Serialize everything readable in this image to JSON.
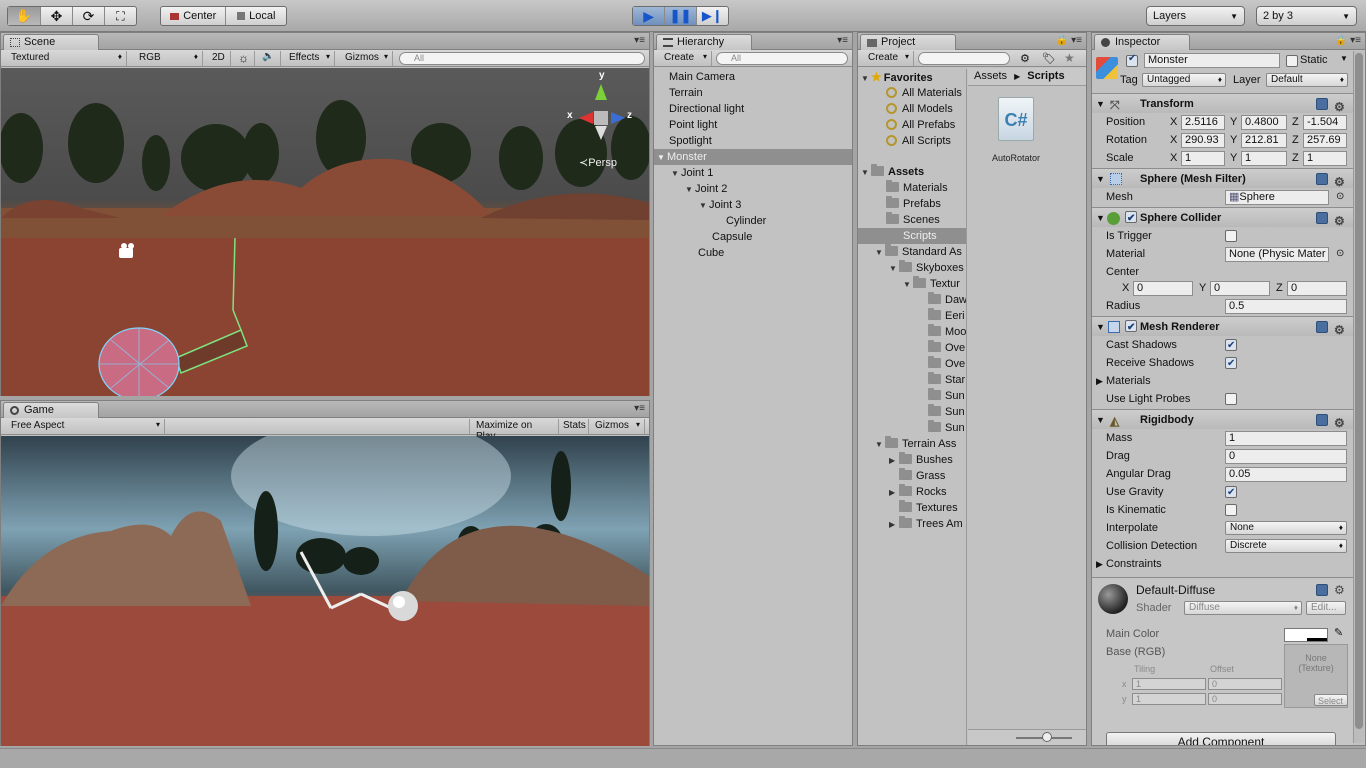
{
  "toolbar": {
    "pivot": "Center",
    "space": "Local",
    "layers": "Layers",
    "layout": "2 by 3"
  },
  "scene": {
    "tab": "Scene",
    "shading": "Textured",
    "render_mode": "RGB",
    "btn_2d": "2D",
    "effects": "Effects",
    "gizmos": "Gizmos",
    "search_placeholder": "All",
    "persp": "Persp",
    "axis_y": "y",
    "axis_x": "x",
    "axis_z": "z"
  },
  "game": {
    "tab": "Game",
    "aspect": "Free Aspect",
    "maximize": "Maximize on Play",
    "stats": "Stats",
    "gizmos": "Gizmos"
  },
  "hierarchy": {
    "tab": "Hierarchy",
    "create": "Create",
    "search_placeholder": "All",
    "items": [
      "Main Camera",
      "Terrain",
      "Directional light",
      "Point light",
      "Spotlight",
      "Monster",
      "Joint 1",
      "Joint 2",
      "Joint 3",
      "Cylinder",
      "Capsule",
      "Cube"
    ]
  },
  "project": {
    "tab": "Project",
    "create": "Create",
    "favorites": "Favorites",
    "fav_items": [
      "All Materials",
      "All Models",
      "All Prefabs",
      "All Scripts"
    ],
    "assets": "Assets",
    "folders": [
      "Materials",
      "Prefabs",
      "Scenes",
      "Scripts",
      "Standard As",
      "Skyboxes",
      "Textur",
      "Daw",
      "Eeri",
      "Moo",
      "Ove",
      "Ove",
      "Star",
      "Sun",
      "Sun",
      "Sun",
      "Terrain Ass",
      "Bushes",
      "Grass",
      "Rocks",
      "Textures",
      "Trees Am"
    ],
    "breadcrumb_root": "Assets",
    "breadcrumb_current": "Scripts",
    "file_name": "AutoRotator",
    "file_glyph": "C#"
  },
  "inspector": {
    "tab": "Inspector",
    "object_name": "Monster",
    "static_label": "Static",
    "tag_label": "Tag",
    "tag_value": "Untagged",
    "layer_label": "Layer",
    "layer_value": "Default",
    "transform": {
      "title": "Transform",
      "position": "Position",
      "rotation": "Rotation",
      "scale": "Scale",
      "pos": [
        "2.5116",
        "0.4800",
        "-1.504"
      ],
      "rot": [
        "290.93",
        "212.81",
        "257.69"
      ],
      "scl": [
        "1",
        "1",
        "1"
      ],
      "x": "X",
      "y": "Y",
      "z": "Z"
    },
    "mesh_filter": {
      "title": "Sphere (Mesh Filter)",
      "mesh_label": "Mesh",
      "mesh_value": "Sphere"
    },
    "collider": {
      "title": "Sphere Collider",
      "is_trigger": "Is Trigger",
      "material": "Material",
      "material_value": "None (Physic Mater",
      "center": "Center",
      "center_vals": [
        "0",
        "0",
        "0"
      ],
      "radius": "Radius",
      "radius_value": "0.5"
    },
    "renderer": {
      "title": "Mesh Renderer",
      "cast": "Cast Shadows",
      "receive": "Receive Shadows",
      "materials": "Materials",
      "light_probes": "Use Light Probes"
    },
    "rigidbody": {
      "title": "Rigidbody",
      "mass": "Mass",
      "mass_value": "1",
      "drag": "Drag",
      "drag_value": "0",
      "angular_drag": "Angular Drag",
      "angular_value": "0.05",
      "use_gravity": "Use Gravity",
      "is_kinematic": "Is Kinematic",
      "interpolate": "Interpolate",
      "interpolate_value": "None",
      "collision": "Collision Detection",
      "collision_value": "Discrete",
      "constraints": "Constraints"
    },
    "material": {
      "name": "Default-Diffuse",
      "shader_label": "Shader",
      "shader_value": "Diffuse",
      "edit": "Edit...",
      "main_color": "Main Color",
      "base": "Base (RGB)",
      "tiling": "Tiling",
      "offset": "Offset",
      "x": "x",
      "y": "y",
      "tx": "1",
      "ty": "1",
      "ox": "0",
      "oy": "0",
      "texture_none": "None\n(Texture)",
      "select": "Select"
    },
    "add_component": "Add Component"
  }
}
